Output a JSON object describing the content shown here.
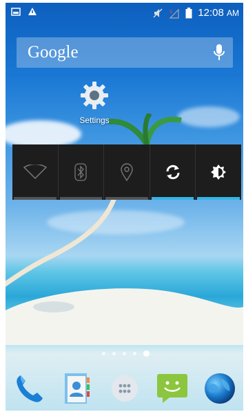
{
  "status_bar": {
    "time": "12:08",
    "ampm": "AM",
    "icons": [
      "screenshot-icon",
      "alert-icon",
      "mute-icon",
      "no-signal-icon",
      "battery-icon"
    ]
  },
  "search_widget": {
    "logo": "Google",
    "icon": "mic-icon"
  },
  "desktop_shortcut": {
    "label": "Settings",
    "icon": "settings-gear-icon"
  },
  "quick_settings": [
    {
      "name": "wifi",
      "icon": "wifi-icon",
      "enabled": false
    },
    {
      "name": "bluetooth",
      "icon": "bluetooth-icon",
      "enabled": false
    },
    {
      "name": "location",
      "icon": "location-icon",
      "enabled": false
    },
    {
      "name": "sync",
      "icon": "sync-icon",
      "enabled": true
    },
    {
      "name": "brightness",
      "icon": "brightness-icon",
      "enabled": true
    }
  ],
  "page_indicator": {
    "count": 5,
    "active": 5
  },
  "dock": [
    {
      "name": "phone",
      "icon": "phone-icon"
    },
    {
      "name": "contacts",
      "icon": "contacts-icon"
    },
    {
      "name": "app-drawer",
      "icon": "app-drawer-icon"
    },
    {
      "name": "messaging",
      "icon": "messaging-icon"
    },
    {
      "name": "browser",
      "icon": "browser-globe-icon"
    }
  ],
  "colors": {
    "accent": "#33b5e5",
    "panel": "#1d1d1d",
    "inactive_bar": "#555555"
  }
}
